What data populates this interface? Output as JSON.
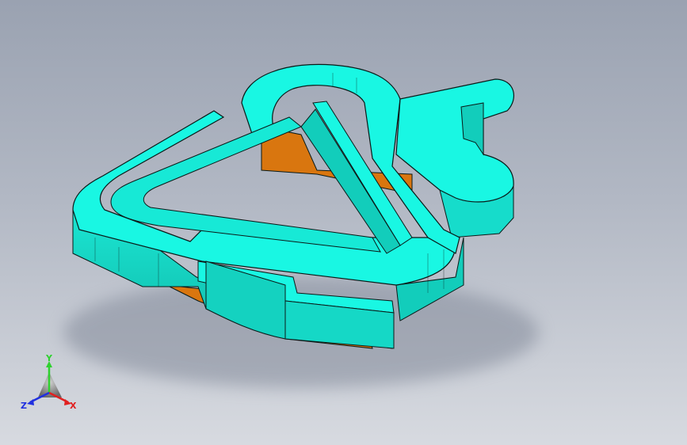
{
  "viewport": {
    "background_top": "#9aa2b1",
    "background_bottom": "#d7dae0"
  },
  "model": {
    "top_face_color": "#19f7e3",
    "side_face_color": "#12cdbb",
    "edge_color": "#0a1a18",
    "underside_color": "#d9760f"
  },
  "triad": {
    "y_label": "Y",
    "x_label": "X",
    "z_label": "Z",
    "y_color": "#2fd12f",
    "x_color": "#e02020",
    "z_color": "#2030e0"
  }
}
